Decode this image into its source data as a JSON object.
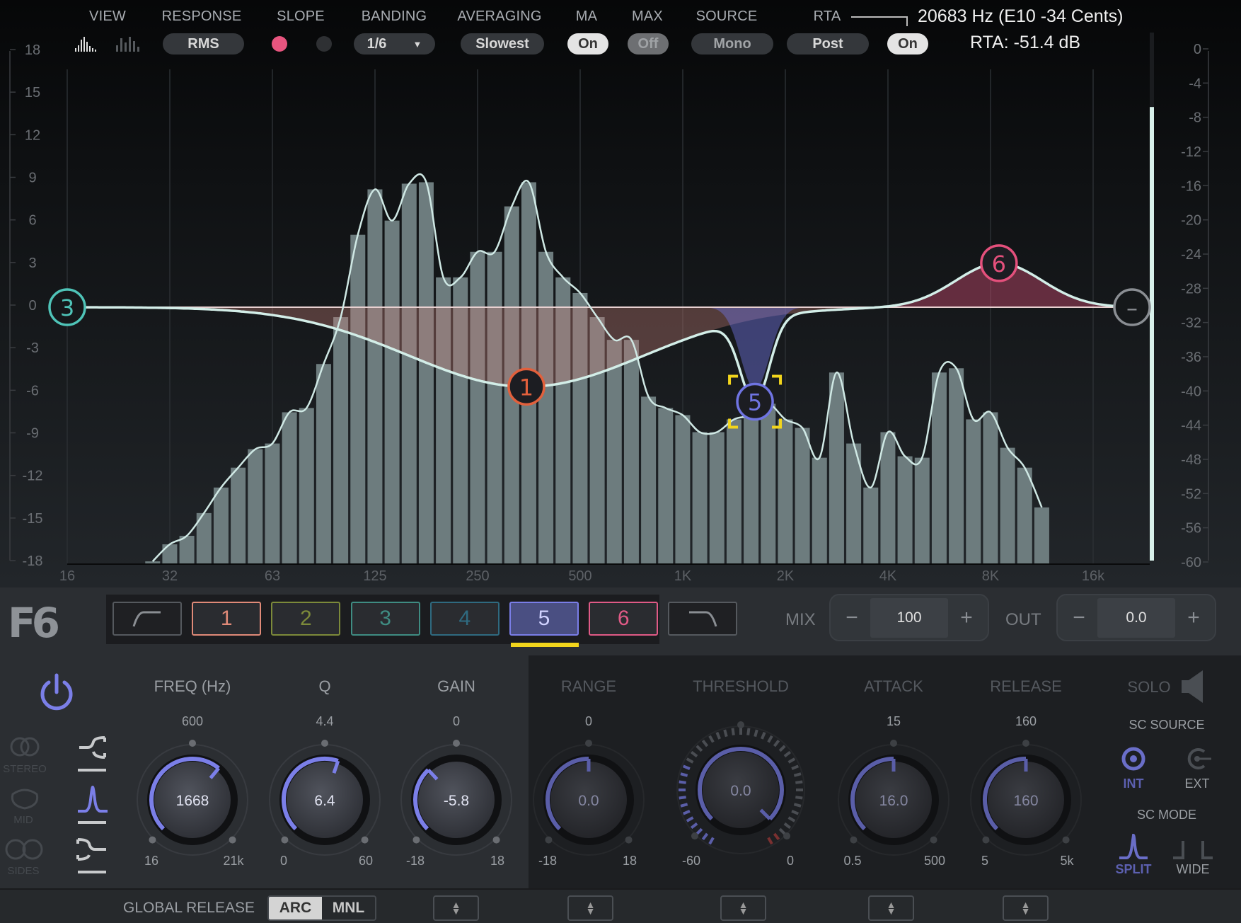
{
  "toolbar": {
    "view_label": "VIEW",
    "view_icons": [
      "spectrum-bars-icon",
      "spectrum-peaks-icon"
    ],
    "response_label": "RESPONSE",
    "response_value": "RMS",
    "slope_label": "SLOPE",
    "slope_colors": [
      "#e8557f",
      "#2e3033"
    ],
    "banding_label": "BANDING",
    "banding_value": "1/6",
    "averaging_label": "AVERAGING",
    "averaging_value": "Slowest",
    "ma_label": "MA",
    "ma_value": "On",
    "max_label": "MAX",
    "max_value": "Off",
    "source_label": "SOURCE",
    "source_value": "Mono",
    "rta_label": "RTA",
    "rta_mode_value": "Post",
    "rta_value": "On"
  },
  "readout": {
    "frequency": "20683 Hz (E10 -34 Cents)",
    "level": "RTA: -51.4 dB"
  },
  "graph": {
    "db_scale": [
      "18",
      "15",
      "12",
      "9",
      "6",
      "3",
      "0",
      "-3",
      "-6",
      "-9",
      "-12",
      "-15",
      "-18"
    ],
    "meter_scale": [
      "0",
      "-4",
      "-8",
      "-12",
      "-16",
      "-20",
      "-24",
      "-28",
      "-32",
      "-36",
      "-40",
      "-44",
      "-48",
      "-52",
      "-56",
      "-60"
    ],
    "freq_labels": [
      {
        "label": "16",
        "hz": 16
      },
      {
        "label": "32",
        "hz": 32
      },
      {
        "label": "63",
        "hz": 64
      },
      {
        "label": "125",
        "hz": 128
      },
      {
        "label": "250",
        "hz": 256
      },
      {
        "label": "500",
        "hz": 512
      },
      {
        "label": "1K",
        "hz": 1024
      },
      {
        "label": "2K",
        "hz": 2048
      },
      {
        "label": "4K",
        "hz": 4096
      },
      {
        "label": "8K",
        "hz": 8192
      },
      {
        "label": "16k",
        "hz": 16384
      }
    ],
    "output_meter_db": -6.8,
    "rta": {
      "banding": "1/6 octave",
      "start_hz": 28.5,
      "values_db": [
        -17.9,
        -16.7,
        -16.1,
        -14.5,
        -12.7,
        -11.3,
        -10.0,
        -9.6,
        -7.4,
        -7.1,
        -4.0,
        -0.7,
        5.1,
        8.3,
        6.1,
        8.7,
        8.8,
        2.1,
        2.1,
        3.9,
        3.9,
        7.1,
        8.8,
        3.9,
        2.1,
        1.0,
        -0.7,
        -2.3,
        -2.3,
        -6.3,
        -7.1,
        -7.6,
        -8.8,
        -8.8,
        -7.9,
        -7.6,
        -6.8,
        -7.9,
        -8.5,
        -10.6,
        -4.6,
        -9.6,
        -12.7,
        -8.8,
        -10.5,
        -10.6,
        -4.6,
        -4.3,
        -7.9,
        -7.4,
        -9.9,
        -11.3,
        -14.1
      ]
    },
    "colors": {
      "curve": "#d3eee8",
      "rta_line": "#cfe8e4",
      "bar": "#6d7c7e",
      "selection": "#f2d51c"
    },
    "nodes": [
      {
        "label": "3",
        "type": "lowcut",
        "freq_hz": 16,
        "gain_db": 0,
        "color": "#4fc4b8"
      },
      {
        "label": "1",
        "type": "bell",
        "freq_hz": 356,
        "gain_db": -5.6,
        "width_oct": 1.15,
        "color": "#e2603c",
        "fill": "rgba(200,130,120,0.35)"
      },
      {
        "label": "5",
        "type": "bell",
        "freq_hz": 1668,
        "gain_db": -5.8,
        "width_oct": 0.14,
        "color": "#6f74e2",
        "fill": "rgba(110,115,225,0.45)",
        "selected": true
      },
      {
        "label": "6",
        "type": "bell",
        "freq_hz": 8670,
        "gain_db": 3.1,
        "width_oct": 0.42,
        "color": "#e4507c",
        "fill": "rgba(220,80,120,0.4)"
      },
      {
        "label": "–",
        "type": "highcut",
        "freq_hz": 20000,
        "gain_db": 0,
        "color": "#8a8e93"
      }
    ]
  },
  "logo": "F6",
  "band_selector": {
    "items": [
      {
        "label": "",
        "type": "lowcut",
        "color": "#55595e",
        "icon": "lowcut-filter-icon"
      },
      {
        "label": "1",
        "color": "#e08a78"
      },
      {
        "label": "2",
        "color": "#7c8a3a"
      },
      {
        "label": "3",
        "color": "#3f8c82"
      },
      {
        "label": "4",
        "color": "#2f6a80"
      },
      {
        "label": "5",
        "color": "#7a7ee8"
      },
      {
        "label": "6",
        "color": "#e05a86"
      },
      {
        "label": "",
        "type": "highcut",
        "color": "#55595e",
        "icon": "highcut-filter-icon"
      }
    ],
    "selected": "5"
  },
  "mix": {
    "label": "MIX",
    "minus": "−",
    "value": "100",
    "plus": "+"
  },
  "out": {
    "label": "OUT",
    "minus": "−",
    "value": "0.0",
    "plus": "+"
  },
  "channel_modes": [
    "STEREO",
    "MID",
    "SIDES"
  ],
  "filter_types": [
    "lowshelf",
    "bell",
    "highshelf"
  ],
  "selected_filter_type": "bell",
  "accent": "#7b7fe8",
  "knobs": [
    {
      "label": "FREQ (Hz)",
      "default": "600",
      "min": "16",
      "max": "21k",
      "value": "1668",
      "position": 0.647,
      "active": true
    },
    {
      "label": "Q",
      "default": "4.4",
      "min": "0",
      "max": "60",
      "value": "6.4",
      "position": 0.57,
      "active": true
    },
    {
      "label": "GAIN",
      "default": "0",
      "min": "-18",
      "max": "18",
      "value": "-5.8",
      "position": 0.34,
      "active": true
    },
    {
      "label": "RANGE",
      "default": "0",
      "min": "-18",
      "max": "18",
      "value": "0.0",
      "position": 0.5,
      "active": false
    },
    {
      "label": "THRESHOLD",
      "default": "",
      "min": "-60",
      "max": "0",
      "value": "0.0",
      "position": 1.0,
      "active": false,
      "big": true
    },
    {
      "label": "ATTACK",
      "default": "15",
      "min": "0.5",
      "max": "500",
      "value": "16.0",
      "position": 0.5,
      "active": false
    },
    {
      "label": "RELEASE",
      "default": "160",
      "min": "5",
      "max": "5k",
      "value": "160",
      "position": 0.5,
      "active": false
    }
  ],
  "sidechain": {
    "solo": "SOLO",
    "source_label": "SC SOURCE",
    "int": "INT",
    "ext": "EXT",
    "source_selected": "INT",
    "mode_label": "SC MODE",
    "split": "SPLIT",
    "wide": "WIDE",
    "mode_selected": "SPLIT"
  },
  "footer": {
    "global_release": "GLOBAL RELEASE",
    "arc": "ARC",
    "mnl": "MNL",
    "selected": "ARC"
  }
}
